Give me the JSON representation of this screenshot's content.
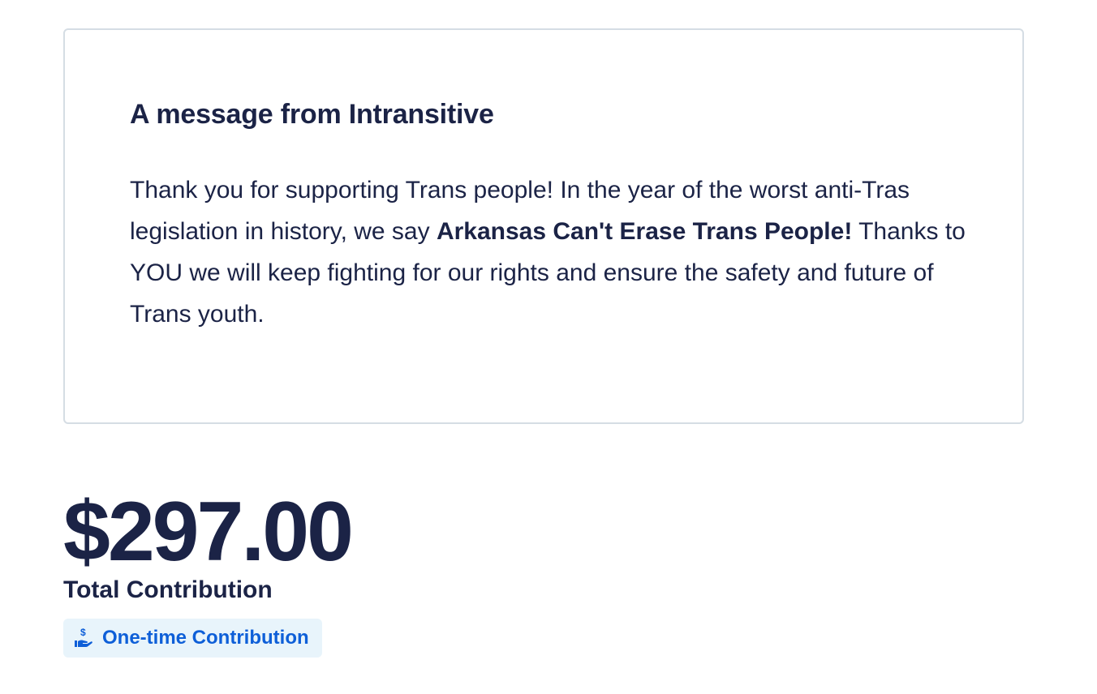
{
  "message": {
    "title": "A message from Intransitive",
    "body_part1": "Thank you for supporting Trans people! In the year of the worst anti-Tras legislation in history, we say ",
    "body_bold": "Arkansas Can't Erase Trans People!",
    "body_part2": " Thanks to YOU we will keep fighting for our rights and ensure the safety and future of Trans youth."
  },
  "contribution": {
    "amount": "$297.00",
    "label": "Total Contribution",
    "type_badge": {
      "label": "One-time Contribution",
      "icon": "hand-dollar-icon"
    }
  },
  "colors": {
    "text_primary": "#1b2346",
    "badge_background": "#e8f4fb",
    "badge_text": "#0e5fd8",
    "card_border": "#d5dde4"
  }
}
